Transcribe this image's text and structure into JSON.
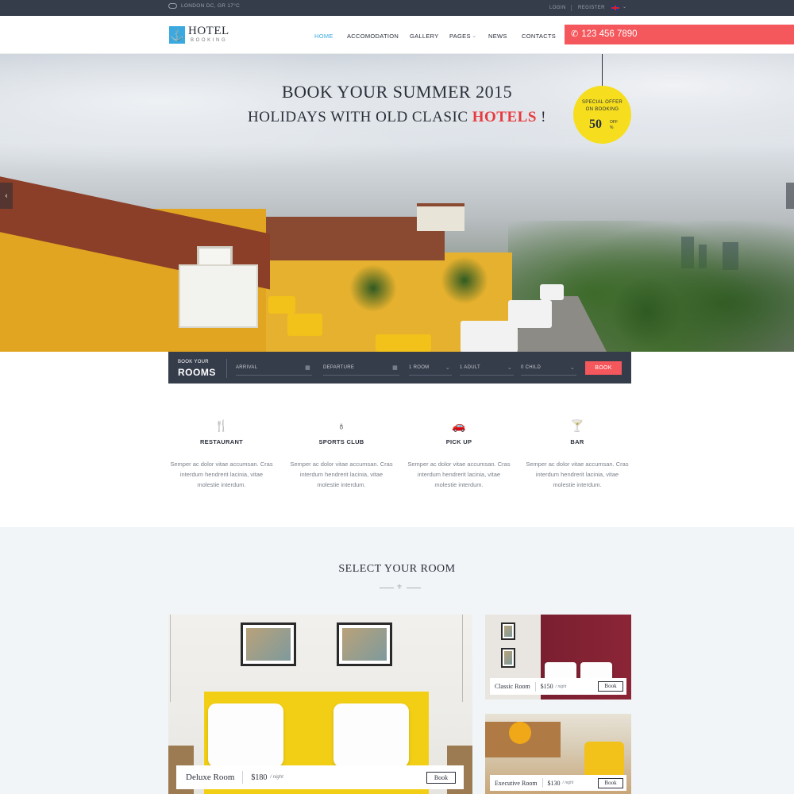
{
  "topbar": {
    "weather": "LONDON DC, GR 17°C",
    "login": "LOGIN",
    "register": "REGISTER",
    "caret": "⌄"
  },
  "header": {
    "logo_title": "HOTEL",
    "logo_sub": "BOOKING",
    "nav": [
      "HOME",
      "ACCOMODATION",
      "GALLERY",
      "PAGES",
      "NEWS",
      "CONTACTS"
    ],
    "nav_active": "HOME",
    "phone": "123 456 7890"
  },
  "hero": {
    "line1": "BOOK YOUR SUMMER 2015",
    "line2_pre": "HOLIDAYS WITH OLD CLASIC ",
    "line2_highlight": "HOTELS",
    "line2_post": " !",
    "badge_line1": "SPECIAL OFFER",
    "badge_line2": "ON BOOKING",
    "badge_value": "50",
    "badge_off": "OFF",
    "badge_pct": "%"
  },
  "booking": {
    "label_small": "BOOK YOUR",
    "label_big": "ROOMS",
    "arrival": "ARRIVAL",
    "departure": "DEPARTURE",
    "rooms": "1 ROOM",
    "adults": "1 ADULT",
    "children": "0 CHILD",
    "button": "BOOK"
  },
  "features": [
    {
      "icon": "restaurant-icon",
      "title": "RESTAURANT",
      "desc": "Semper ac dolor vitae accumsan. Cras interdum hendrerit lacinia, vitae molestie interdum."
    },
    {
      "icon": "sports-club-icon",
      "title": "SPORTS CLUB",
      "desc": "Semper ac dolor vitae accumsan. Cras interdum hendrerit lacinia, vitae molestie interdum."
    },
    {
      "icon": "car-icon",
      "title": "PICK UP",
      "desc": "Semper ac dolor vitae accumsan. Cras interdum hendrerit lacinia, vitae molestie interdum."
    },
    {
      "icon": "cocktail-icon",
      "title": "BAR",
      "desc": "Semper ac dolor vitae accumsan. Cras interdum hendrerit lacinia, vitae molestie interdum."
    }
  ],
  "rooms": {
    "title": "SELECT YOUR ROOM",
    "items": [
      {
        "name": "Deluxe Room",
        "price": "$180",
        "per": "/ night",
        "button": "Book"
      },
      {
        "name": "Classic Room",
        "price": "$150",
        "per": "/ night",
        "button": "Book"
      },
      {
        "name": "Executive Room",
        "price": "$130",
        "per": "/ night",
        "button": "Book"
      }
    ]
  },
  "colors": {
    "accent": "#3aa9e0",
    "cta": "#f4575c",
    "dark": "#353c4a",
    "badge": "#f6de1e"
  }
}
